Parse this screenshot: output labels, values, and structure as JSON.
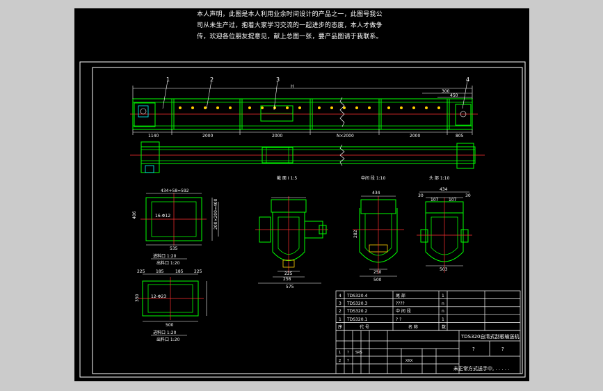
{
  "colors": {
    "background": "#000000",
    "frame": "#ffffff",
    "structure": "#00ff00",
    "centerline": "#ff3030",
    "dimension": "#ffffff",
    "accent": "#00ffff",
    "outer": "#cbcbcb"
  },
  "notes": [
    "本人声明，此图是本人利用业余时间设计的产品之一，此图号我公",
    "司从未生产过，抱着大家学习交流的一起进步的态度，本人才做争",
    "传，欢迎各位朋友提意见，献上总图一张，要产品图请于我联系。"
  ],
  "callouts": [
    "1",
    "2",
    "3",
    "4"
  ],
  "elevation": {
    "total_label": "H",
    "right_dims": [
      "300",
      "450"
    ],
    "bottom_dims": [
      "1140",
      "2000",
      "2000",
      "N×2000",
      "2000",
      "805"
    ]
  },
  "sections": {
    "a": "截 面 I  1:5",
    "b": "中间 段 1:10",
    "c": "头 部 1:10"
  },
  "section_dims": {
    "a_top": "434",
    "a_dims": [
      "225",
      "256",
      "575"
    ],
    "b_top": "434",
    "b_dims": [
      "282",
      "250",
      "500"
    ],
    "c_top": [
      "30",
      "434",
      "30"
    ],
    "c_sub": [
      "107",
      "107"
    ],
    "c_bottom": "503"
  },
  "flanges": {
    "one": {
      "top_dim": "434+58=592",
      "hole_note": "16-Φ12",
      "side_dims": [
        "406",
        "200×200=400"
      ],
      "bottom_dim": "535",
      "title": "进料口 1:20",
      "subtitle": "出料口 1:20"
    },
    "two": {
      "top_dims": [
        "225",
        "185",
        "185",
        "225"
      ],
      "hole_note": "12-Φ23",
      "side_dims": [
        "350"
      ],
      "bottom_dim": "500",
      "title": "进料口 1:20",
      "subtitle": "出料口 1:20"
    }
  },
  "bom": {
    "rows": [
      {
        "no": "4",
        "code": "TDS320.4",
        "name": "尾 部",
        "qty": "1"
      },
      {
        "no": "3",
        "code": "TDS320.3",
        "name": "????",
        "qty": "n"
      },
      {
        "no": "2",
        "code": "TDS320.2",
        "name": "中 间 段",
        "qty": "n"
      },
      {
        "no": "1",
        "code": "TDS320.1",
        "name": "? ?",
        "qty": "1"
      }
    ],
    "footer": [
      "序",
      "代 号",
      "名 称",
      "数"
    ]
  },
  "title_block": {
    "drawing_title": "TDS320自清式刮板输送机",
    "cells": [
      "?",
      "?"
    ],
    "small": [
      "1",
      "?",
      "SRS",
      "2",
      "?",
      "XXX"
    ],
    "company": "未正常方式送手中,  . . . . ."
  }
}
